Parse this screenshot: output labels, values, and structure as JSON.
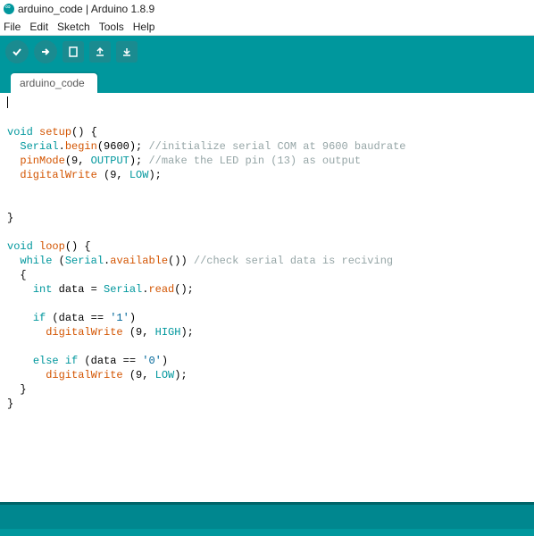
{
  "window": {
    "title": "arduino_code | Arduino 1.8.9"
  },
  "menu": {
    "file": "File",
    "edit": "Edit",
    "sketch": "Sketch",
    "tools": "Tools",
    "help": "Help"
  },
  "tab": {
    "name": "arduino_code"
  },
  "code": {
    "l1": "",
    "l2_kw": "void",
    "l2_fn": "setup",
    "l2_rest": "() {",
    "l3_a": "  ",
    "l3_obj": "Serial",
    "l3_dot": ".",
    "l3_fn": "begin",
    "l3_args": "(9600); ",
    "l3_com": "//initialize serial COM at 9600 baudrate",
    "l4_a": "  ",
    "l4_fn": "pinMode",
    "l4_args1": "(9, ",
    "l4_const": "OUTPUT",
    "l4_args2": "); ",
    "l4_com": "//make the LED pin (13) as output",
    "l5_a": "  ",
    "l5_fn": "digitalWrite",
    "l5_args1": " (9, ",
    "l5_const": "LOW",
    "l5_args2": ");",
    "l8": "}",
    "l10_kw": "void",
    "l10_fn": "loop",
    "l10_rest": "() {",
    "l11_a": "  ",
    "l11_kw": "while",
    "l11_b": " (",
    "l11_obj": "Serial",
    "l11_dot": ".",
    "l11_fn": "available",
    "l11_c": "()) ",
    "l11_com": "//check serial data is reciving",
    "l12": "  {",
    "l13_a": "    ",
    "l13_type": "int",
    "l13_b": " data = ",
    "l13_obj": "Serial",
    "l13_dot": ".",
    "l13_fn": "read",
    "l13_c": "();",
    "l15_a": "    ",
    "l15_kw": "if",
    "l15_b": " (data == ",
    "l15_str": "'1'",
    "l15_c": ")",
    "l16_a": "      ",
    "l16_fn": "digitalWrite",
    "l16_b": " (9, ",
    "l16_const": "HIGH",
    "l16_c": ");",
    "l18_a": "    ",
    "l18_kw": "else if",
    "l18_b": " (data == ",
    "l18_str": "'0'",
    "l18_c": ")",
    "l19_a": "      ",
    "l19_fn": "digitalWrite",
    "l19_b": " (9, ",
    "l19_const": "LOW",
    "l19_c": ");",
    "l20": "  }",
    "l21": "}"
  }
}
